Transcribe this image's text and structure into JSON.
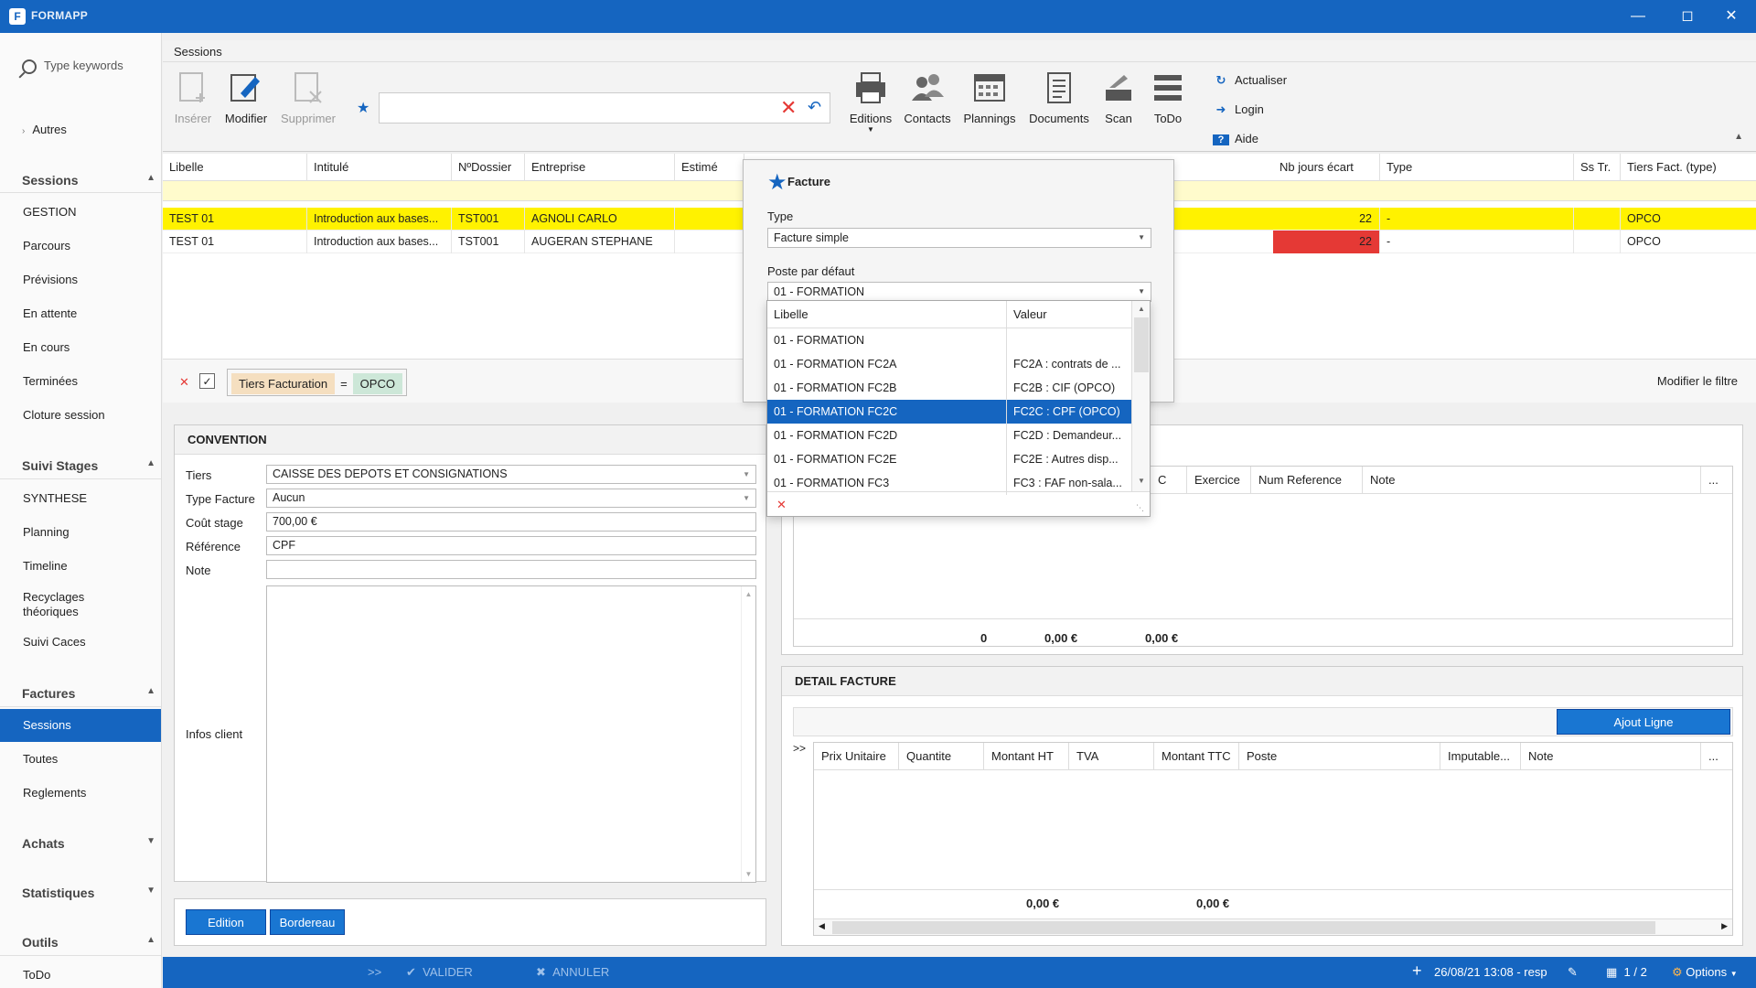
{
  "app": {
    "title": "FORMAPP"
  },
  "sidebar": {
    "search_placeholder": "Type keywords",
    "autres": "Autres",
    "sections": {
      "sessions": {
        "title": "Sessions",
        "items": [
          "GESTION",
          "Parcours",
          "Prévisions",
          "En attente",
          "En cours",
          "Terminées",
          "Cloture session"
        ]
      },
      "suivi": {
        "title": "Suivi Stages",
        "items": [
          "SYNTHESE",
          "Planning",
          "Timeline",
          "Recyclages théoriques",
          "Suivi Caces"
        ]
      },
      "factures": {
        "title": "Factures",
        "items": [
          "Sessions",
          "Toutes",
          "Reglements"
        ],
        "active": "Sessions"
      },
      "achats": {
        "title": "Achats"
      },
      "statistiques": {
        "title": "Statistiques"
      },
      "outils": {
        "title": "Outils",
        "items": [
          "ToDo"
        ]
      }
    }
  },
  "tab": {
    "title": "Sessions"
  },
  "toolbar": {
    "inserer": "Insérer",
    "modifier": "Modifier",
    "supprimer": "Supprimer",
    "editions": "Editions",
    "contacts": "Contacts",
    "plannings": "Plannings",
    "documents": "Documents",
    "scan": "Scan",
    "todo": "ToDo",
    "actualiser": "Actualiser",
    "login": "Login",
    "aide": "Aide",
    "search_value": ""
  },
  "grid": {
    "columns": [
      "Libelle",
      "Intitulé",
      "NºDossier",
      "Entreprise",
      "Estimé",
      "Nb jours écart",
      "Type",
      "Ss Tr.",
      "Tiers Fact. (type)"
    ],
    "rows": [
      {
        "libelle": "TEST 01",
        "intitule": "Introduction aux bases...",
        "dossier": "TST001",
        "entreprise": "AGNOLI CARLO",
        "nbjours": "22",
        "type": "-",
        "tiers": "OPCO"
      },
      {
        "libelle": "TEST 01",
        "intitule": "Introduction aux bases...",
        "dossier": "TST001",
        "entreprise": "AUGERAN STEPHANE",
        "nbjours": "22",
        "type": "-",
        "tiers": "OPCO"
      }
    ],
    "filter": {
      "field": "Tiers Facturation",
      "op": "=",
      "value": "OPCO",
      "modify": "Modifier le filtre"
    }
  },
  "convention": {
    "title": "CONVENTION",
    "fields": {
      "tiers": {
        "label": "Tiers",
        "value": "CAISSE DES DEPOTS ET CONSIGNATIONS"
      },
      "type_facture": {
        "label": "Type Facture",
        "value": "Aucun"
      },
      "cout": {
        "label": "Coût stage",
        "value": "700,00 €"
      },
      "reference": {
        "label": "Référence",
        "value": "CPF"
      },
      "note": {
        "label": "Note",
        "value": ""
      },
      "infos": {
        "label": "Infos client",
        "value": ""
      }
    },
    "buttons": {
      "edition": "Edition",
      "bordereau": "Bordereau"
    }
  },
  "right_grid": {
    "columns": [
      "C",
      "Exercice",
      "Num Reference",
      "Note",
      "..."
    ],
    "totals": [
      "0",
      "0,00 €",
      "0,00 €"
    ]
  },
  "detail": {
    "title": "DETAIL FACTURE",
    "add_line": "Ajout Ligne",
    "expand": ">>",
    "columns": [
      "Prix Unitaire",
      "Quantite",
      "Montant HT",
      "TVA",
      "Montant TTC",
      "Poste",
      "Imputable...",
      "Note",
      "..."
    ],
    "totals": [
      "0,00 €",
      "0,00 €"
    ]
  },
  "popup": {
    "title": "Facture",
    "type_label": "Type",
    "type_value": "Facture simple",
    "poste_label": "Poste par défaut",
    "poste_value": "01 - FORMATION",
    "list_columns": [
      "Libelle",
      "Valeur"
    ],
    "options": [
      {
        "libelle": "01 - FORMATION",
        "valeur": ""
      },
      {
        "libelle": "01 - FORMATION FC2A",
        "valeur": "FC2A : contrats de ..."
      },
      {
        "libelle": "01 - FORMATION FC2B",
        "valeur": "FC2B : CIF (OPCO)"
      },
      {
        "libelle": "01 - FORMATION FC2C",
        "valeur": "FC2C : CPF (OPCO)"
      },
      {
        "libelle": "01 - FORMATION FC2D",
        "valeur": "FC2D : Demandeur..."
      },
      {
        "libelle": "01 - FORMATION FC2E",
        "valeur": "FC2E : Autres disp..."
      },
      {
        "libelle": "01 - FORMATION FC3",
        "valeur": "FC3 : FAF non-sala..."
      }
    ],
    "selected_index": 3
  },
  "statusbar": {
    "expand": ">>",
    "valider": "VALIDER",
    "annuler": "ANNULER",
    "datetime": "26/08/21 13:08 - resp",
    "pages": "1 / 2",
    "options": "Options"
  },
  "colors": {
    "accent": "#1565c0",
    "selected_row": "#fff200",
    "alert": "#e53935"
  }
}
